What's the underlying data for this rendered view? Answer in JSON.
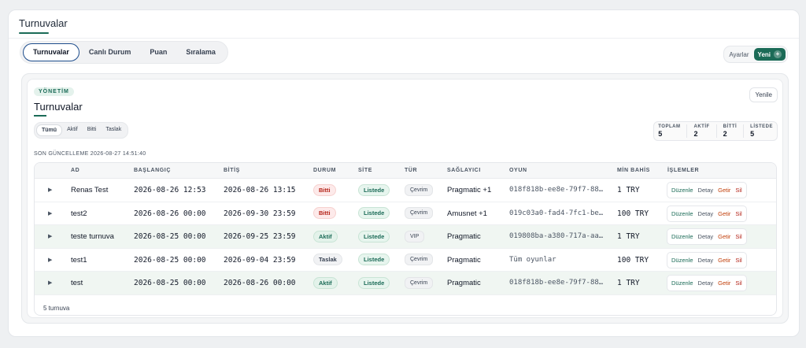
{
  "page": {
    "title": "Turnuvalar"
  },
  "tabs": [
    {
      "label": "Turnuvalar",
      "active": true
    },
    {
      "label": "Canlı Durum",
      "active": false
    },
    {
      "label": "Puan",
      "active": false
    },
    {
      "label": "Sıralama",
      "active": false
    }
  ],
  "top_actions": {
    "settings_label": "Ayarlar",
    "new_label": "Yeni",
    "new_icon": "plus-icon"
  },
  "card": {
    "badge": "YÖNETİM",
    "title": "Turnuvalar",
    "refresh_label": "Yenile",
    "filters": [
      {
        "label": "Tümü",
        "active": true
      },
      {
        "label": "Aktif",
        "active": false
      },
      {
        "label": "Bitti",
        "active": false
      },
      {
        "label": "Taslak",
        "active": false
      }
    ],
    "stats": [
      {
        "label": "TOPLAM",
        "value": "5"
      },
      {
        "label": "AKTİF",
        "value": "2"
      },
      {
        "label": "BİTTİ",
        "value": "2"
      },
      {
        "label": "LİSTEDE",
        "value": "5"
      }
    ],
    "updated": "SON GÜNCELLEME 2026-08-27 14:51:40"
  },
  "table": {
    "headers": [
      "AD",
      "BAŞLANGIÇ",
      "BİTİŞ",
      "DURUM",
      "SİTE",
      "TÜR",
      "SAĞLAYICI",
      "OYUN",
      "MİN BAHİS",
      "İŞLEMLER"
    ],
    "action_labels": {
      "edit": "Düzenle",
      "detail": "Detay",
      "fetch": "Getir",
      "delete": "Sil"
    },
    "rows": [
      {
        "name": "Renas Test",
        "start": "2026-08-26 12:53",
        "end": "2026-08-26 13:15",
        "status": "Bitti",
        "site": "Listede",
        "type": "Çevrim",
        "provider": "Pragmatic +1",
        "game": "018f818b-ee8e-79f7-88…",
        "min_bet": "1 TRY"
      },
      {
        "name": "test2",
        "start": "2026-08-26 00:00",
        "end": "2026-09-30 23:59",
        "status": "Bitti",
        "site": "Listede",
        "type": "Çevrim",
        "provider": "Amusnet +1",
        "game": "019c03a0-fad4-7fc1-be…",
        "min_bet": "100 TRY"
      },
      {
        "name": "teste turnuva",
        "start": "2026-08-25 00:00",
        "end": "2026-09-25 23:59",
        "status": "Aktif",
        "site": "Listede",
        "type": "VIP",
        "provider": "Pragmatic",
        "game": "019808ba-a380-717a-aa…",
        "min_bet": "1 TRY"
      },
      {
        "name": "test1",
        "start": "2026-08-25 00:00",
        "end": "2026-09-04 23:59",
        "status": "Taslak",
        "site": "Listede",
        "type": "Çevrim",
        "provider": "Pragmatic",
        "game": "Tüm oyunlar",
        "min_bet": "100 TRY"
      },
      {
        "name": "test",
        "start": "2026-08-25 00:00",
        "end": "2026-08-26 00:00",
        "status": "Aktif",
        "site": "Listede",
        "type": "Çevrim",
        "provider": "Pragmatic",
        "game": "018f818b-ee8e-79f7-88…",
        "min_bet": "1 TRY"
      }
    ],
    "footer": "5 turnuva"
  },
  "colors": {
    "accent": "#1b6b57",
    "danger": "#b42318",
    "warning": "#c2410c",
    "tab_border": "#1e4d8c"
  }
}
